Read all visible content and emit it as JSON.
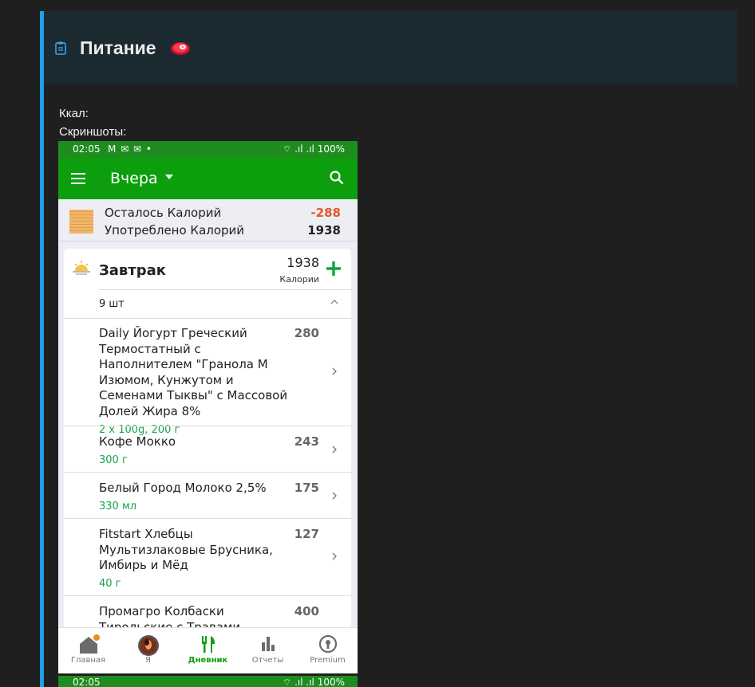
{
  "header": {
    "title": "Питание",
    "icon": "clipboard-icon",
    "emoji": "meat-emoji"
  },
  "fields": {
    "kcal_label": "Ккал:",
    "screenshots_label": "Скриншоты:"
  },
  "phone": {
    "status": {
      "time": "02:05",
      "notifs": "M ✉ ✉ •",
      "right": "⌔ .ıl .ıl 100%"
    },
    "appbar": {
      "title": "Вчера"
    },
    "summary": {
      "remaining_label": "Осталось Калорий",
      "remaining_value": "-288",
      "consumed_label": "Употреблено Калорий",
      "consumed_value": "1938"
    },
    "meal": {
      "title": "Завтрак",
      "kcal": "1938",
      "kcal_label": "Калории",
      "count": "9 шт",
      "items": [
        {
          "name": "Daily Йогурт Греческий Термостатный с Наполнителем \"Гранола М Изюмом, Кунжутом и Семенами Тыквы\" с Массовой Долей Жира 8%",
          "kcal": "280",
          "amount": "2 x 100g, 200 г"
        },
        {
          "name": "Кофе Мокко",
          "kcal": "243",
          "amount": "300 г"
        },
        {
          "name": "Белый Город Молоко 2,5%",
          "kcal": "175",
          "amount": "330 мл"
        },
        {
          "name": "Fitstart Хлебцы Мультизлаковые Брусника, Имбирь и Мёд",
          "kcal": "127",
          "amount": "40 г"
        },
        {
          "name": "Промагро Колбаски Тирольские с Травами",
          "kcal": "400",
          "amount": ""
        }
      ]
    },
    "nav": [
      {
        "label": "Главная",
        "icon": "home-icon"
      },
      {
        "label": "Я",
        "icon": "avatar"
      },
      {
        "label": "Дневник",
        "icon": "fork-knife-icon"
      },
      {
        "label": "Отчеты",
        "icon": "bar-chart-icon"
      },
      {
        "label": "Premium",
        "icon": "premium-icon"
      }
    ]
  },
  "next_status": {
    "time": "02:05",
    "right": "⌔ .ıl .ıl 100%"
  },
  "colors": {
    "accent": "#1e9fe8",
    "brand_green": "#0d9e0d",
    "negative": "#e05a2a",
    "amount_green": "#1aa34a"
  }
}
